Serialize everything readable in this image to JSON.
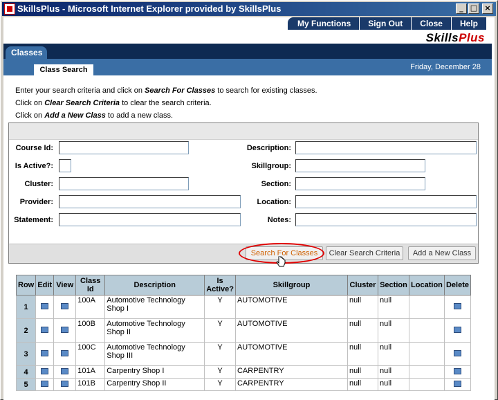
{
  "window": {
    "title": "SkillsPlus - Microsoft Internet Explorer provided by SkillsPlus",
    "minimize_glyph": "_",
    "maximize_glyph": "□",
    "close_glyph": "×"
  },
  "topnav": {
    "items": [
      "My Functions",
      "Sign Out",
      "Close",
      "Help"
    ]
  },
  "logo": {
    "part1": "Skills",
    "part2": "Plus"
  },
  "tabs": {
    "main": "Classes",
    "sub": "Class Search"
  },
  "date": "Friday, December 28",
  "instructions": {
    "line1_pre": "Enter your search criteria and click on ",
    "line1_bold": "Search For Classes",
    "line1_post": " to search for existing classes.",
    "line2_pre": "Click on ",
    "line2_bold": "Clear Search Criteria",
    "line2_post": " to clear the search criteria.",
    "line3_pre": "Click on ",
    "line3_bold": "Add a New Class",
    "line3_post": " to add a new class."
  },
  "form": {
    "course_id_label": "Course Id:",
    "is_active_label": "Is Active?:",
    "cluster_label": "Cluster:",
    "provider_label": "Provider:",
    "statement_label": "Statement:",
    "description_label": "Description:",
    "skillgroup_label": "Skillgroup:",
    "section_label": "Section:",
    "location_label": "Location:",
    "notes_label": "Notes:",
    "search_button": "Search For Classes",
    "clear_button": "Clear Search Criteria",
    "add_button": "Add a New Class"
  },
  "table": {
    "headers": {
      "row": "Row",
      "edit": "Edit",
      "view": "View",
      "class_id": "Class Id",
      "description": "Description",
      "is_active": "Is Active?",
      "skillgroup": "Skillgroup",
      "cluster": "Cluster",
      "section": "Section",
      "location": "Location",
      "delete": "Delete"
    },
    "rows": [
      {
        "row": "1",
        "class_id": "100A",
        "description": "Automotive Technology Shop I",
        "active": "Y",
        "skillgroup": "AUTOMOTIVE",
        "cluster": "null",
        "section": "null",
        "location": ""
      },
      {
        "row": "2",
        "class_id": "100B",
        "description": "Automotive Technology Shop II",
        "active": "Y",
        "skillgroup": "AUTOMOTIVE",
        "cluster": "null",
        "section": "null",
        "location": ""
      },
      {
        "row": "3",
        "class_id": "100C",
        "description": "Automotive Technology Shop III",
        "active": "Y",
        "skillgroup": "AUTOMOTIVE",
        "cluster": "null",
        "section": "null",
        "location": ""
      },
      {
        "row": "4",
        "class_id": "101A",
        "description": "Carpentry Shop I",
        "active": "Y",
        "skillgroup": "CARPENTRY",
        "cluster": "null",
        "section": "null",
        "location": ""
      },
      {
        "row": "5",
        "class_id": "101B",
        "description": "Carpentry Shop II",
        "active": "Y",
        "skillgroup": "CARPENTRY",
        "cluster": "null",
        "section": "null",
        "location": ""
      }
    ]
  }
}
